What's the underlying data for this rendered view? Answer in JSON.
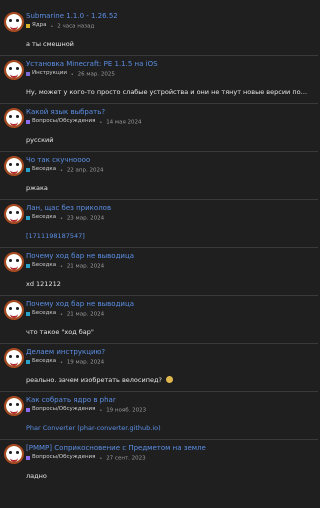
{
  "colors": {
    "background": "#1f1f1f",
    "link": "#5b8fe6",
    "meta": "#9b9b9b",
    "divider": "#3a3a3a",
    "category_core": "#d8b32a",
    "category_instructions": "#7c6bd6",
    "category_questions": "#8b6cf0",
    "category_chat": "#2aa1c7"
  },
  "posts": [
    {
      "title": "Submarine 1.1.0 - 1.26.52",
      "category": "Ядра",
      "category_color": "#d8b32a",
      "time": "2 часа назад",
      "body": "а ты смешной"
    },
    {
      "title": "Установка Minecraft: PE 1.1.5 на iOS",
      "category": "Инструкции",
      "category_color": "#7c6bd6",
      "time": "26 мар. 2025",
      "body": "Ну, может у кого-то просто слабые устройства и они не тянут новые версии попросту"
    },
    {
      "title": "Какой язык выбрать?",
      "category": "Вопросы/Обсуждения",
      "category_color": "#8b6cf0",
      "time": "14 мая 2024",
      "body": "русский"
    },
    {
      "title": "Чо так скучноооо",
      "category": "Беседка",
      "category_color": "#2aa1c7",
      "time": "22 апр. 2024",
      "body": "ржака"
    },
    {
      "title": "Лан, щас без приколов",
      "category": "Беседка",
      "category_color": "#2aa1c7",
      "time": "23 мар. 2024",
      "body": "[1711198187547]"
    },
    {
      "title": "Почему ход бар не выводица",
      "category": "Беседка",
      "category_color": "#2aa1c7",
      "time": "21 мар. 2024",
      "body": "xd 121212"
    },
    {
      "title": "Почему ход бар не выводица",
      "category": "Беседка",
      "category_color": "#2aa1c7",
      "time": "21 мар. 2024",
      "body": "что такое \"ход бар\""
    },
    {
      "title": "Делаем инструкцию?",
      "category": "Беседка",
      "category_color": "#2aa1c7",
      "time": "19 мар. 2024",
      "body": "реально. зачем изобретать велосипед?",
      "emoji": "grimacing-face-icon"
    },
    {
      "title": "Как собрать ядро в phar",
      "category": "Вопросы/Обсуждения",
      "category_color": "#8b6cf0",
      "time": "19 нояб. 2023",
      "body": "Phar Converter (phar-converter.github.io)"
    },
    {
      "title": "[PMMP] Соприкосновение с Предметом на земле",
      "category": "Вопросы/Обсуждения",
      "category_color": "#8b6cf0",
      "time": "27 сент. 2023",
      "body": "ладно"
    }
  ]
}
